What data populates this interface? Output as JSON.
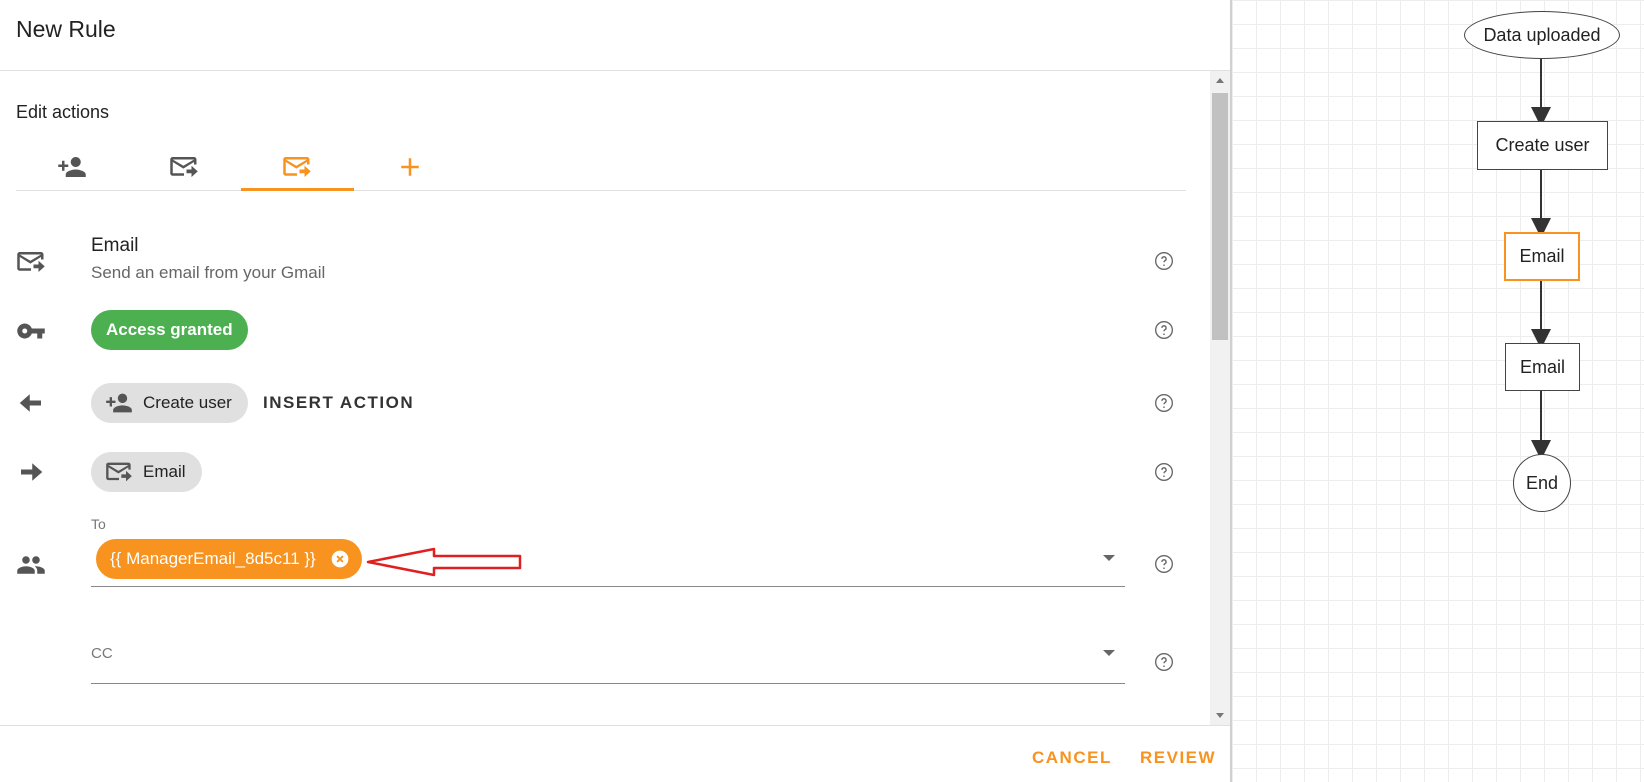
{
  "header": {
    "title": "New Rule"
  },
  "section": {
    "title": "Edit actions"
  },
  "tabs": [
    {
      "icon": "person-add-icon"
    },
    {
      "icon": "forward-email-icon"
    },
    {
      "icon": "forward-email-icon",
      "active": true
    },
    {
      "icon": "plus-icon",
      "label": "+"
    }
  ],
  "action": {
    "title": "Email",
    "subtitle": "Send an email from your Gmail",
    "access_label": "Access granted",
    "previous_action": "Create user",
    "insert_action_label": "INSERT ACTION",
    "next_action": "Email"
  },
  "fields": {
    "to_label": "To",
    "to_chip": "{{ ManagerEmail_8d5c11 }}",
    "cc_label": "CC"
  },
  "footer": {
    "cancel": "CANCEL",
    "review": "REVIEW"
  },
  "flow": {
    "nodes": [
      "Data uploaded",
      "Create user",
      "Email",
      "Email",
      "End"
    ],
    "active_index": 2
  },
  "colors": {
    "accent": "#f7931e",
    "success": "#4caf50",
    "annotation": "#e02020"
  }
}
